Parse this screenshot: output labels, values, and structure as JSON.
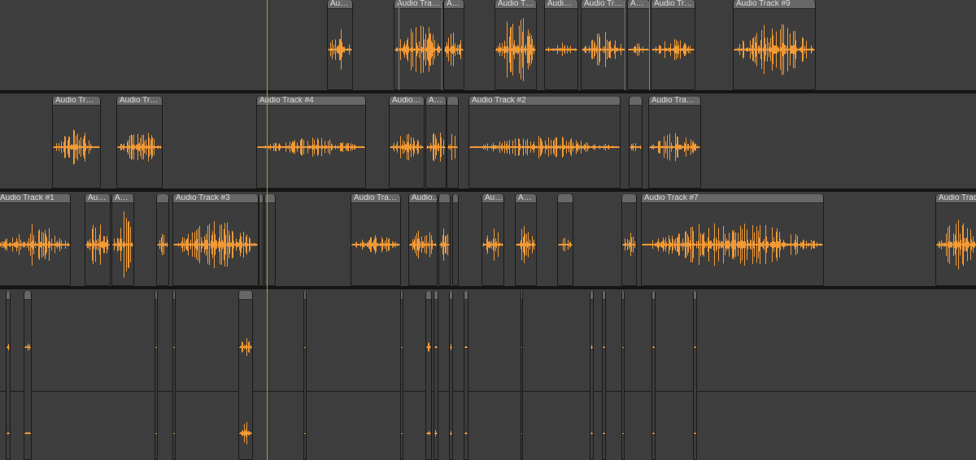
{
  "colors": {
    "background": "#3d3d3d",
    "clip": "#3c3c3c",
    "clip_header": "#676767",
    "waveform": "#f29a36",
    "playhead": "#a7a23a",
    "separator": "#151515"
  },
  "tracks": [
    {
      "name": "lane-1",
      "clips": [
        {
          "label": "Au…"
        },
        {
          "label": "Audio Tra…"
        },
        {
          "label": "A…"
        },
        {
          "label": "Audio T…"
        },
        {
          "label": "Audi…"
        },
        {
          "label": "Audio Tr…"
        },
        {
          "label": "A…"
        },
        {
          "label": "Audio Tr…"
        },
        {
          "label": "Audio Track #9"
        }
      ]
    },
    {
      "name": "lane-2",
      "clips": [
        {
          "label": "Audio Tr…"
        },
        {
          "label": "Audio Tr…"
        },
        {
          "label": "Audio Track #4"
        },
        {
          "label": "Audio…"
        },
        {
          "label": "A…"
        },
        {
          "label": ""
        },
        {
          "label": "Audio Track #2"
        },
        {
          "label": ""
        },
        {
          "label": "Audio Tra…"
        }
      ]
    },
    {
      "name": "lane-3",
      "clips": [
        {
          "label": "Audio Track #1"
        },
        {
          "label": "Au…"
        },
        {
          "label": "A…"
        },
        {
          "label": ""
        },
        {
          "label": "Audio Track #3"
        },
        {
          "label": ""
        },
        {
          "label": ""
        },
        {
          "label": "Audio Tra…"
        },
        {
          "label": "Audio…"
        },
        {
          "label": ""
        },
        {
          "label": ""
        },
        {
          "label": "Au…"
        },
        {
          "label": "A…"
        },
        {
          "label": ""
        },
        {
          "label": ""
        },
        {
          "label": "Audio Track #7"
        },
        {
          "label": "Audio Trac…"
        }
      ]
    },
    {
      "name": "lane-4",
      "clips": []
    }
  ]
}
